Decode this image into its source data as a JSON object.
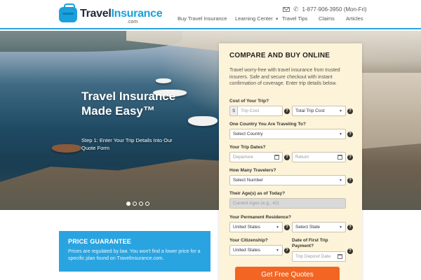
{
  "header": {
    "logo_text_a": "Travel",
    "logo_text_b": "Insurance",
    "logo_suffix": ".com",
    "phone": "1-877-906-3950 (Mon-Fri)",
    "nav": [
      {
        "label": "Buy Travel Insurance"
      },
      {
        "label": "Learning Center"
      },
      {
        "label": "Travel Tips"
      },
      {
        "label": "Claims"
      },
      {
        "label": "Articles"
      }
    ]
  },
  "hero": {
    "title": "Travel Insurance Made Easy™",
    "subtitle": "Step 1: Enter Your Trip Details Into Our Quote Form",
    "slides": 4,
    "active_slide": 1
  },
  "form": {
    "title": "COMPARE AND BUY ONLINE",
    "description": "Travel worry-free with travel insurance from trusted insurers. Safe and secure checkout with instant confirmation of coverage. Enter trip details below.",
    "cost_label": "Cost of Your Trip?",
    "currency": "$",
    "trip_cost_placeholder": "Trip Cost",
    "total_trip_cost_select": "Total Trip Cost",
    "country_label": "One Country You Are Traveling To?",
    "country_select": "Select Country",
    "dates_label": "Your Trip Dates?",
    "departure_placeholder": "Departure",
    "return_placeholder": "Return",
    "travelers_label": "How Many Travelers?",
    "travelers_select": "Select Number",
    "ages_label": "Their Age(s) as of Today?",
    "ages_placeholder": "Current Ages (e.g., 42)",
    "residence_label": "Your Permanent Residence?",
    "residence_country": "United States",
    "residence_state": "Select State",
    "citizenship_label": "Your Citizenship?",
    "citizenship_country": "United States",
    "first_payment_label": "Date of First Trip Payment?",
    "first_payment_placeholder": "Trip Deposit Date",
    "cta": "Get Free Quotes",
    "help": "?"
  },
  "guarantee": {
    "title": "PRICE GUARANTEE",
    "body": "Prices are regulated by law. You won't find a lower price for a specific plan found on TravelInsurance.com."
  },
  "colors": {
    "brand_blue": "#2aa4e0",
    "cta_orange": "#f26522",
    "panel_bg": "#fdf3d8"
  }
}
